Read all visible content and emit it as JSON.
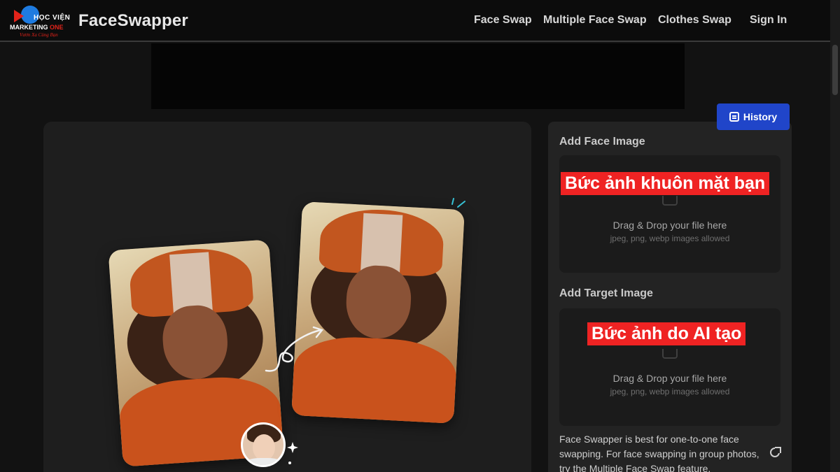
{
  "logo": {
    "line1": "HỌC VIỆN",
    "line2_prefix": "MARKETING",
    "line2_suffix": "ONE",
    "slogan": "Vươn Xa Cùng Bạn"
  },
  "header": {
    "brand": "FaceSwapper",
    "nav": [
      "Face Swap",
      "Multiple Face Swap",
      "Clothes Swap"
    ],
    "sign_in": "Sign In"
  },
  "history_button": {
    "label": "History"
  },
  "face_section": {
    "title": "Add Face Image",
    "drop_title": "Drag & Drop your file here",
    "drop_subtitle": "jpeg, png, webp images allowed",
    "overlay": "Bức ảnh khuôn mặt bạn"
  },
  "target_section": {
    "title": "Add Target Image",
    "drop_title": "Drag & Drop your file here",
    "drop_subtitle": "jpeg, png, webp images allowed",
    "overlay": "Bức ảnh do AI tạo"
  },
  "note": "Face Swapper is best for one-to-one face swapping. For face swapping in group photos, try the Multiple Face Swap feature.",
  "colors": {
    "accent": "#2045c9",
    "overlay": "#ef2323",
    "background": "#121212"
  },
  "icons": [
    "history-icon",
    "upload-icon",
    "external-link-icon",
    "swap-arrow-icon",
    "sparkle-icon"
  ]
}
